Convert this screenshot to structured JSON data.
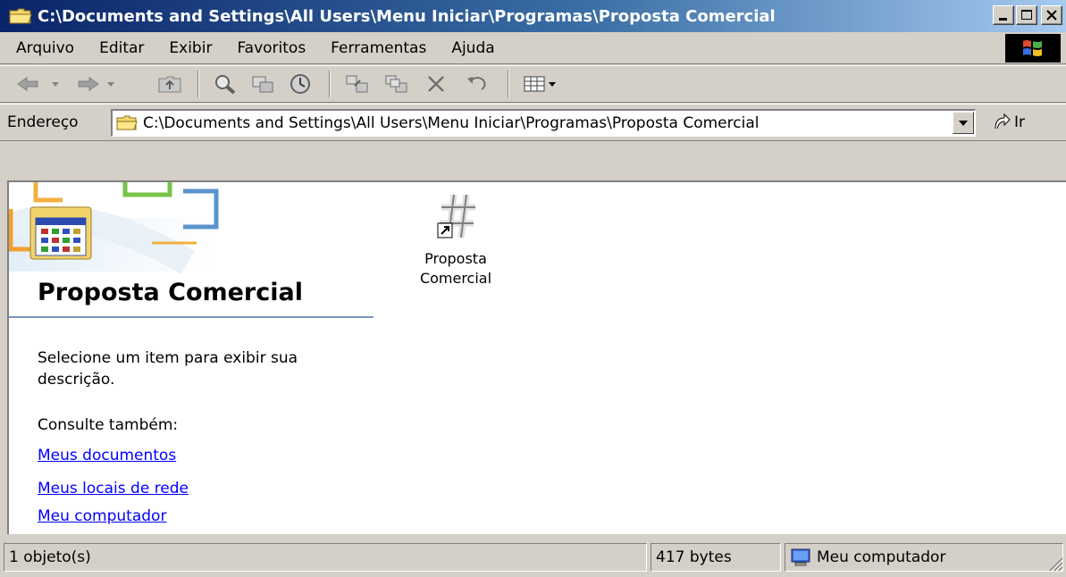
{
  "window": {
    "title": "C:\\Documents and Settings\\All Users\\Menu Iniciar\\Programas\\Proposta Comercial"
  },
  "menu": {
    "items": [
      "Arquivo",
      "Editar",
      "Exibir",
      "Favoritos",
      "Ferramentas",
      "Ajuda"
    ]
  },
  "toolbar": {
    "buttons": [
      "back-icon",
      "forward-icon",
      "up-folder-icon",
      "search-icon",
      "folders-icon",
      "history-icon",
      "move-to-icon",
      "copy-to-icon",
      "delete-icon",
      "undo-icon",
      "views-icon"
    ]
  },
  "address": {
    "label": "Endereço",
    "value": "C:\\Documents and Settings\\All Users\\Menu Iniciar\\Programas\\Proposta Comercial",
    "go_label": "Ir"
  },
  "panel": {
    "title": "Proposta Comercial",
    "description": "Selecione um item para exibir sua descrição.",
    "see_also": "Consulte também:",
    "links": [
      "Meus documentos",
      "Meus locais de rede",
      "Meu computador"
    ]
  },
  "files": [
    {
      "name_line1": "Proposta",
      "name_line2": "Comercial",
      "icon": "shortcut-hash-icon"
    }
  ],
  "status": {
    "objects": "1 objeto(s)",
    "size": "417 bytes",
    "zone": "Meu computador"
  },
  "colors": {
    "title_start": "#0a246a",
    "title_end": "#a6caf0",
    "chrome": "#d4d0c8",
    "link": "#0000ff",
    "panel_rule": "#7a96c7"
  }
}
